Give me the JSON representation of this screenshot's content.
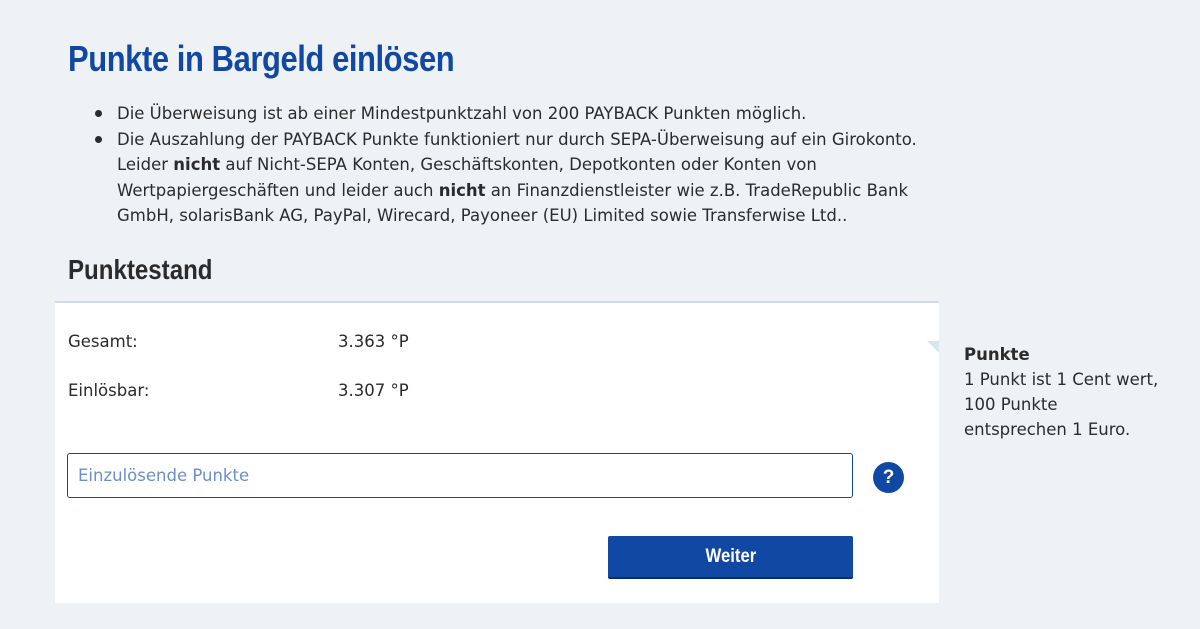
{
  "page": {
    "title": "Punkte in Bargeld einlösen",
    "bullets": [
      {
        "text": "Die Überweisung ist ab einer Mindestpunktzahl von 200 PAYBACK Punkten möglich."
      },
      {
        "part1": "Die Auszahlung der PAYBACK Punkte funktioniert nur durch SEPA-Überweisung auf ein Girokonto. Leider ",
        "bold1": "nicht",
        "part2": " auf Nicht-SEPA Konten, Geschäftskonten, Depotkonten oder Konten von Wertpapiergeschäften und leider auch ",
        "bold2": "nicht",
        "part3": " an Finanzdienstleister wie z.B. TradeRepublic Bank GmbH, solarisBank AG, PayPal, Wirecard, Payoneer (EU) Limited sowie Transferwise Ltd.."
      }
    ]
  },
  "balance": {
    "title": "Punktestand",
    "total_label": "Gesamt:",
    "total_value": "3.363 °P",
    "redeemable_label": "Einlösbar:",
    "redeemable_value": "3.307 °P",
    "input_placeholder": "Einzulösende Punkte",
    "input_value": "",
    "help_icon": "question-mark-icon",
    "help_glyph": "?",
    "submit_label": "Weiter"
  },
  "side": {
    "title": "Punkte",
    "lines": [
      "1 Punkt ist 1 Cent wert,",
      "100 Punkte",
      "entsprechen 1 Euro."
    ]
  },
  "colors": {
    "accent": "#1148a3",
    "background": "#eff2f5",
    "card": "#ffffff",
    "text": "#2b2b2b",
    "placeholder": "#6b8fca"
  }
}
